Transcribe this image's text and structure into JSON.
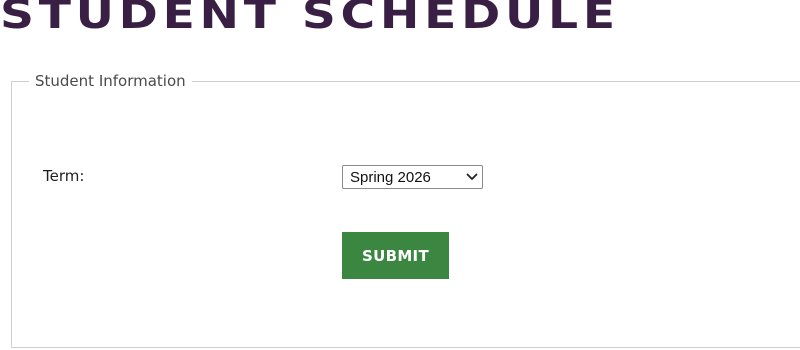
{
  "header": {
    "title": "STUDENT SCHEDULE"
  },
  "student_info": {
    "legend": "Student Information",
    "term_label": "Term:",
    "term_selected": "Spring 2026",
    "submit_label": "SUBMIT"
  },
  "colors": {
    "title": "#3a1f45",
    "submit_background": "#3b8741",
    "submit_text": "#ffffff",
    "fieldset_border": "#cfcfcf"
  },
  "icons": {
    "select_indicator": "chevron-down-icon"
  }
}
